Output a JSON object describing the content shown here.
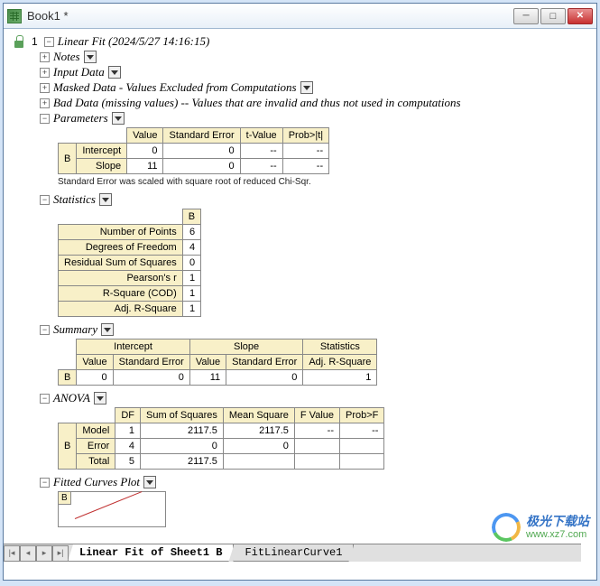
{
  "window": {
    "title": "Book1 *"
  },
  "root": {
    "number": "1",
    "title": "Linear Fit (2024/5/27 14:16:15)"
  },
  "sections": {
    "notes": "Notes",
    "input_data": "Input Data",
    "masked": "Masked Data - Values Excluded from Computations",
    "bad": "Bad Data (missing values) -- Values that are invalid and thus not used in computations",
    "parameters": "Parameters",
    "statistics": "Statistics",
    "summary": "Summary",
    "anova": "ANOVA",
    "fitted_plot": "Fitted Curves Plot"
  },
  "params": {
    "headers": [
      "Value",
      "Standard Error",
      "t-Value",
      "Prob>|t|"
    ],
    "rowgroup": "B",
    "rows": [
      {
        "label": "Intercept",
        "value": "0",
        "stderr": "0",
        "tval": "--",
        "prob": "--"
      },
      {
        "label": "Slope",
        "value": "11",
        "stderr": "0",
        "tval": "--",
        "prob": "--"
      }
    ],
    "footnote": "Standard Error was scaled with square root of reduced Chi-Sqr."
  },
  "stats": {
    "col": "B",
    "rows": [
      {
        "label": "Number of Points",
        "val": "6"
      },
      {
        "label": "Degrees of Freedom",
        "val": "4"
      },
      {
        "label": "Residual Sum of Squares",
        "val": "0"
      },
      {
        "label": "Pearson's r",
        "val": "1"
      },
      {
        "label": "R-Square (COD)",
        "val": "1"
      },
      {
        "label": "Adj. R-Square",
        "val": "1"
      }
    ]
  },
  "summary": {
    "group_headers": [
      "Intercept",
      "Slope",
      "Statistics"
    ],
    "sub_headers": [
      "Value",
      "Standard Error",
      "Value",
      "Standard Error",
      "Adj. R-Square"
    ],
    "rowgroup": "B",
    "row": [
      "0",
      "0",
      "11",
      "0",
      "1"
    ]
  },
  "anova": {
    "headers": [
      "DF",
      "Sum of Squares",
      "Mean Square",
      "F Value",
      "Prob>F"
    ],
    "rowgroup": "B",
    "rows": [
      {
        "label": "Model",
        "df": "1",
        "ss": "2117.5",
        "ms": "2117.5",
        "f": "--",
        "p": "--"
      },
      {
        "label": "Error",
        "df": "4",
        "ss": "0",
        "ms": "0",
        "f": "",
        "p": ""
      },
      {
        "label": "Total",
        "df": "5",
        "ss": "2117.5",
        "ms": "",
        "f": "",
        "p": ""
      }
    ]
  },
  "plot": {
    "rowgroup": "B"
  },
  "tabs": {
    "active": "Linear Fit of Sheet1 B",
    "inactive": "FitLinearCurve1"
  },
  "watermark": {
    "cn": "极光下载站",
    "url": "www.xz7.com"
  }
}
